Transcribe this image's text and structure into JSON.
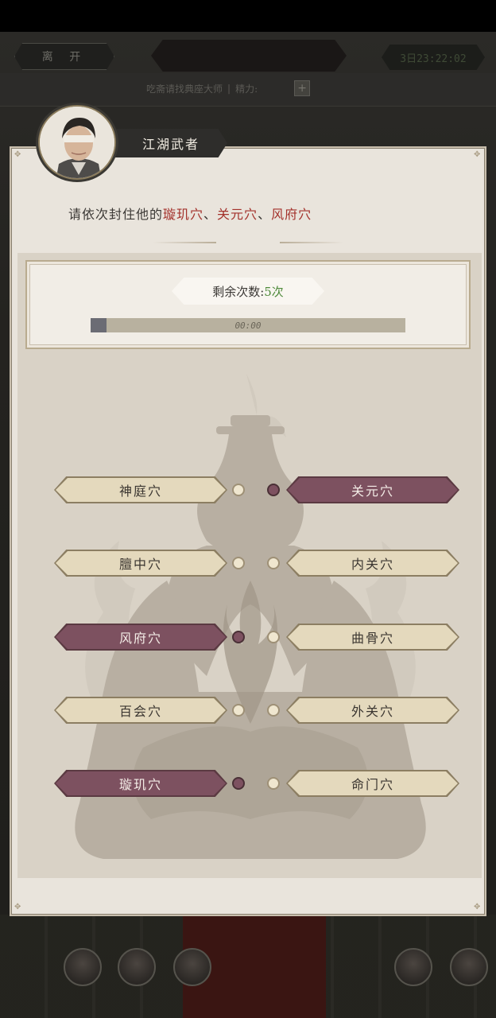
{
  "header": {
    "leave_label": "离 开",
    "title": "",
    "timer": "3日23:22:02",
    "hint": "吃斋请找典座大师",
    "stamina_label": "精力:",
    "plus_label": "+"
  },
  "npc": {
    "name": "江湖武者"
  },
  "instruction": {
    "prefix": "请依次封住他的",
    "targets": [
      "璇玑穴",
      "关元穴",
      "风府穴"
    ],
    "sep": "、"
  },
  "counter": {
    "label": "剩余次数:",
    "remaining": "5次",
    "timer_text": "00:00",
    "progress": 0.05
  },
  "acupoints": {
    "left": [
      {
        "label": "神庭穴",
        "selected": false
      },
      {
        "label": "膻中穴",
        "selected": false
      },
      {
        "label": "风府穴",
        "selected": true
      },
      {
        "label": "百会穴",
        "selected": false
      },
      {
        "label": "璇玑穴",
        "selected": true
      }
    ],
    "right": [
      {
        "label": "关元穴",
        "selected": true
      },
      {
        "label": "内关穴",
        "selected": false
      },
      {
        "label": "曲骨穴",
        "selected": false
      },
      {
        "label": "外关穴",
        "selected": false
      },
      {
        "label": "命门穴",
        "selected": false
      }
    ]
  },
  "colors": {
    "selected": "#7d5160",
    "unselected": "#e4d9bd",
    "highlight_text": "#a3312b",
    "count_text": "#4e8a3a"
  }
}
